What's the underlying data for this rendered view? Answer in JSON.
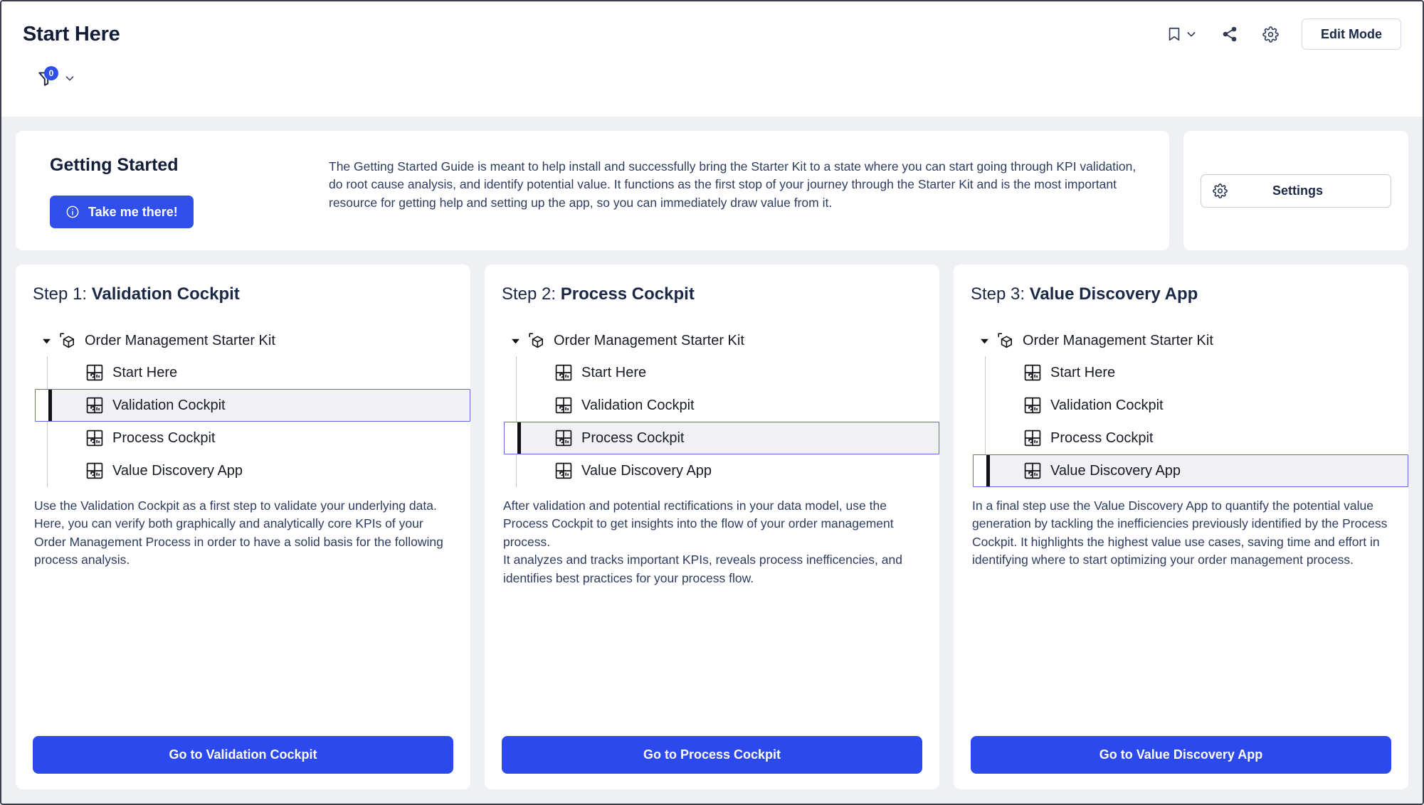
{
  "header": {
    "title": "Start Here",
    "filter": {
      "icon": "filter-funnel-icon",
      "badge_count": "0",
      "chevron": "chevron-down-icon"
    },
    "actions": {
      "bookmark_icon": "bookmark-icon",
      "bookmark_chevron": "chevron-down-icon",
      "share_icon": "share-icon",
      "gear_icon": "gear-icon",
      "edit_mode_label": "Edit Mode"
    }
  },
  "getting_started": {
    "title": "Getting Started",
    "button_label": "Take me there!",
    "button_icon": "info-circle-icon",
    "description": "The Getting Started Guide is meant to help install and successfully bring the Starter Kit to a state where you can start going through KPI validation, do root cause analysis, and identify potential value. It functions as the first stop of your journey through the Starter Kit and is the most important resource for getting help and setting up the app, so you can immediately draw value from it."
  },
  "settings_card": {
    "button_label": "Settings",
    "button_icon": "gear-icon"
  },
  "steps": [
    {
      "prefix": "Step 1: ",
      "name": "Validation Cockpit",
      "tree": {
        "root_label": "Order Management Starter Kit",
        "root_icon": "package-cube-icon",
        "items": [
          {
            "label": "Start Here",
            "selected": false
          },
          {
            "label": "Validation Cockpit",
            "selected": true
          },
          {
            "label": "Process Cockpit",
            "selected": false
          },
          {
            "label": "Value Discovery App",
            "selected": false
          }
        ]
      },
      "description_lines": [
        "Use the Validation Cockpit as a first step to validate your underlying data.",
        "Here, you can verify both graphically and analytically core KPIs of your Order Management Process in order to have a solid basis for the following process analysis."
      ],
      "cta_label": "Go to Validation Cockpit"
    },
    {
      "prefix": "Step 2: ",
      "name": "Process Cockpit",
      "tree": {
        "root_label": "Order Management Starter Kit",
        "root_icon": "package-cube-icon",
        "items": [
          {
            "label": "Start Here",
            "selected": false
          },
          {
            "label": "Validation Cockpit",
            "selected": false
          },
          {
            "label": "Process Cockpit",
            "selected": true
          },
          {
            "label": "Value Discovery App",
            "selected": false
          }
        ]
      },
      "description_lines": [
        "After validation and potential rectifications in your data model, use the Process Cockpit to get insights into the flow of your order management process.",
        "It analyzes and tracks important KPIs, reveals process inefficencies, and identifies best practices for your process flow."
      ],
      "cta_label": "Go to Process Cockpit"
    },
    {
      "prefix": "Step 3: ",
      "name": "Value Discovery App",
      "tree": {
        "root_label": "Order Management Starter Kit",
        "root_icon": "package-cube-icon",
        "items": [
          {
            "label": "Start Here",
            "selected": false
          },
          {
            "label": "Validation Cockpit",
            "selected": false
          },
          {
            "label": "Process Cockpit",
            "selected": false
          },
          {
            "label": "Value Discovery App",
            "selected": true
          }
        ]
      },
      "description_lines": [
        "In a final step use the Value Discovery App to quantify the potential value generation by tackling the inefficiencies previously identified by the Process Cockpit. It highlights the highest value use cases, saving time and effort in identifying where to start optimizing your order management process."
      ],
      "cta_label": "Go to Value Discovery App"
    }
  ],
  "colors": {
    "accent_blue": "#2b49ec",
    "badge_blue": "#2f4fe8",
    "title_navy": "#131d38",
    "body_text": "#2e3c5e",
    "page_bg": "#eef0f4",
    "selection_border": "#5f6ae0",
    "selection_fill": "#f1f1f5"
  }
}
